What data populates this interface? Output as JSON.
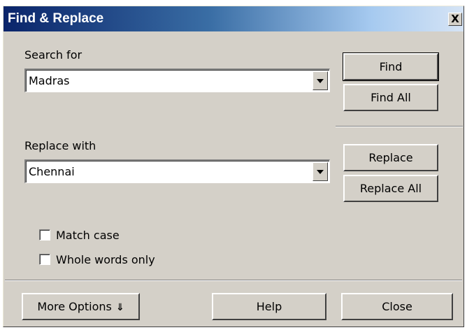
{
  "window": {
    "title": "Find & Replace",
    "close_glyph": "X"
  },
  "search": {
    "label": "Search for",
    "value": "Madras"
  },
  "replace": {
    "label": "Replace with",
    "value": "Chennai"
  },
  "buttons": {
    "find": "Find",
    "find_all": "Find All",
    "replace": "Replace",
    "replace_all": "Replace All",
    "more_options": "More Options",
    "help": "Help",
    "close": "Close"
  },
  "options": {
    "match_case": {
      "label": "Match case",
      "checked": false
    },
    "whole_words": {
      "label": "Whole words only",
      "checked": false
    }
  },
  "icons": {
    "close": "close-icon",
    "dropdown": "chevron-down-icon",
    "more": "double-chevron-down-icon"
  },
  "colors": {
    "title_start": "#0a246a",
    "title_end": "#a6caf0",
    "face": "#d4d0c8"
  }
}
